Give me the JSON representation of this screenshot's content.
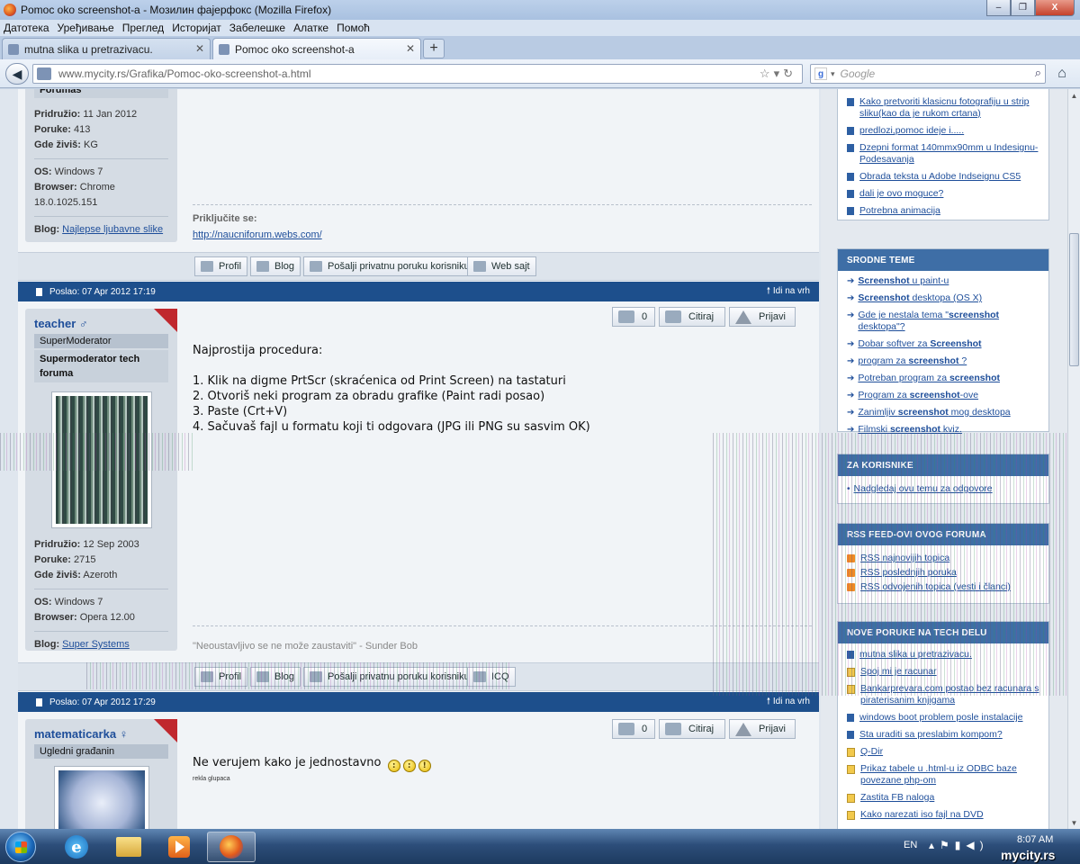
{
  "window": {
    "title": "Pomoc oko screenshot-a - Мозилин фајерфокс (Mozilla Firefox)",
    "buttons": [
      "–",
      "❐",
      "X"
    ]
  },
  "menu": [
    "Датотека",
    "Уређивање",
    "Преглед",
    "Историјат",
    "Забелешке",
    "Алатке",
    "Помоћ"
  ],
  "tabs": [
    {
      "label": "mutna slika u pretrazivacu."
    },
    {
      "label": "Pomoc oko screenshot-a"
    }
  ],
  "nav": {
    "url": "www.mycity.rs/Grafika/Pomoc-oko-screenshot-a.html",
    "search_placeholder": "Google"
  },
  "posts": {
    "prev": {
      "partial_rank": "Forumas",
      "joined": "11 Jan 2012",
      "posts": "413",
      "location": "KG",
      "os": "Windows 7",
      "browser": "Chrome 18.0.1025.151",
      "blog": "Najlepse ljubavne slike",
      "sig_label": "Priključite se:",
      "sig_link": "http://naucniforum.webs.com/"
    },
    "teacher": {
      "posted": "Poslao: 07 Apr 2012 17:19",
      "top": "Idi na vrh",
      "name": "teacher ♂",
      "rank": "SuperModerator",
      "rank2": "Supermoderator tech foruma",
      "joined": "12 Sep 2003",
      "posts": "2715",
      "location": "Azeroth",
      "os": "Windows 7",
      "browser": "Opera 12.00",
      "blog": "Super Systems",
      "likes": "0",
      "quote": "Citiraj",
      "report": "Prijavi",
      "lines": [
        "Najprostija procedura:",
        "",
        "1. Klik na digme PrtScr (skraćenica od Print Screen) na tastaturi",
        "2. Otvoriš neki program za obradu grafike (Paint radi posao)",
        "3. Paste (Crt+V)",
        "4. Sačuvaš fajl u formatu koji ti odgovara (JPG ili PNG su sasvim OK)"
      ],
      "signature": "\"Neoustavljivo se ne može zaustaviti\" - Sunder Bob"
    },
    "matematicarka": {
      "posted": "Poslao: 07 Apr 2012 17:29",
      "top": "Idi na vrh",
      "name": "matematicarka ♀",
      "rank": "Ugledni građanin",
      "likes": "0",
      "quote": "Citiraj",
      "report": "Prijavi",
      "text": "Ne verujem kako je jednostavno",
      "note": "rekla glupaca"
    }
  },
  "labels": {
    "joined": "Pridružio:",
    "posts": "Poruke:",
    "location": "Gde živiš:",
    "os": "OS:",
    "browser": "Browser:",
    "blog": "Blog:",
    "profile": "Profil",
    "blog_btn": "Blog",
    "pm": "Pošalji privatnu poruku korisniku",
    "web": "Web sajt",
    "icq": "ICQ"
  },
  "sidebar": {
    "top_links": [
      "Kako pretvoriti klasicnu fotografiju u strip sliku(kao da je rukom crtana)",
      "predlozi,pomoc ideje i.....",
      "Dzepni format 140mmx90mm u Indesignu-Podesavanja",
      "Obrada teksta u Adobe Indseignu CS5",
      "dali je ovo moguce?",
      "Potrebna animacija"
    ],
    "related_title": "SRODNE TEME",
    "related": [
      {
        "pre": "",
        "bold": "Screenshot",
        "post": " u paint-u"
      },
      {
        "pre": "",
        "bold": "Screenshot",
        "post": " desktopa (OS X)"
      },
      {
        "pre": "Gde je nestala tema \"",
        "bold": "screenshot",
        "post": " desktopa\"?"
      },
      {
        "pre": "Dobar softver za ",
        "bold": "Screenshot",
        "post": ""
      },
      {
        "pre": "program za ",
        "bold": "screenshot",
        "post": " ?"
      },
      {
        "pre": "Potreban program za ",
        "bold": "screenshot",
        "post": ""
      },
      {
        "pre": "Program za ",
        "bold": "screenshot",
        "post": "-ove"
      },
      {
        "pre": "Zanimljiv ",
        "bold": "screenshot",
        "post": " mog desktopa"
      },
      {
        "pre": "Filmski ",
        "bold": "screenshot",
        "post": " kviz."
      }
    ],
    "users_title": "ZA KORISNIKE",
    "users_link": "Nadgledaj ovu temu za odgovore",
    "rss_title": "RSS FEED-OVI OVOG FORUMA",
    "rss": [
      "RSS najnovijih topica",
      "RSS poslednjih poruka",
      "RSS odvojenih topica (vesti i članci)"
    ],
    "new_title": "NOVE PORUKE NA TECH DELU",
    "new": [
      "mutna slika u pretrazivacu.",
      "Spoj mi je racunar",
      "Bankarprevara.com postao bez racunara s piraterisanim knjigama",
      "windows boot problem posle instalacije",
      "Sta uraditi sa preslabim kompom?",
      "Q-Dir",
      "Prikaz tabele u .html-u iz ODBC baze povezane php-om",
      "Zastita FB naloga",
      "Kako narezati iso fajl na DVD"
    ]
  },
  "taskbar": {
    "lang": "EN",
    "time": "8:07 AM",
    "watermark": "mycity.rs"
  }
}
